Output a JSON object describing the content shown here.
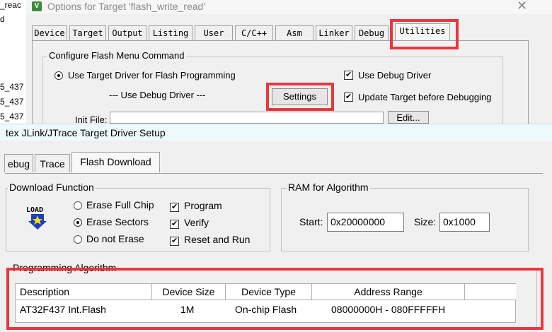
{
  "left_strip": {
    "lines": [
      "_reac",
      "d",
      "5_437",
      "5_437",
      "5_437"
    ]
  },
  "top_dialog": {
    "title": "Options for Target 'flash_write_read'",
    "app_icon": "V",
    "close_icon": "close-icon",
    "tabs": [
      "Device",
      "Target",
      "Output",
      "Listing",
      "User",
      "C/C++",
      "Asm",
      "Linker",
      "Debug",
      "Utilities"
    ],
    "active_tab": "Utilities",
    "group_title": "Configure Flash Menu Command",
    "radio_use_target_driver": "Use Target Driver for Flash Programming",
    "debug_driver_caption": "--- Use Debug Driver ---",
    "settings_button": "Settings",
    "chk_use_debug_driver": "Use Debug Driver",
    "chk_update_target": "Update Target before Debugging",
    "init_file_label": "Init File:",
    "edit_button": "Edit..."
  },
  "bottom_dialog": {
    "title": "tex JLink/JTrace Target Driver Setup",
    "tabs": [
      "ebug",
      "Trace",
      "Flash Download"
    ],
    "active_tab": "Flash Download",
    "download_function": {
      "title": "Download Function",
      "icon_text": "LOAD",
      "radio_erase_full": "Erase Full Chip",
      "radio_erase_sectors": "Erase Sectors",
      "radio_no_erase": "Do not Erase",
      "chk_program": "Program",
      "chk_verify": "Verify",
      "chk_reset_run": "Reset and Run"
    },
    "ram": {
      "title": "RAM for Algorithm",
      "start_label": "Start:",
      "start_value": "0x20000000",
      "size_label": "Size:",
      "size_value": "0x1000"
    },
    "programming_algorithm": {
      "title": "Programming Algorithm",
      "columns": [
        "Description",
        "Device Size",
        "Device Type",
        "Address Range"
      ],
      "rows": [
        {
          "description": "AT32F437 Int.Flash",
          "size": "1M",
          "type": "On-chip Flash",
          "range": "08000000H - 080FFFFFH"
        }
      ]
    }
  },
  "colors": {
    "highlight": "#e8373f",
    "bottom_title_bg": "#eefaf9"
  }
}
